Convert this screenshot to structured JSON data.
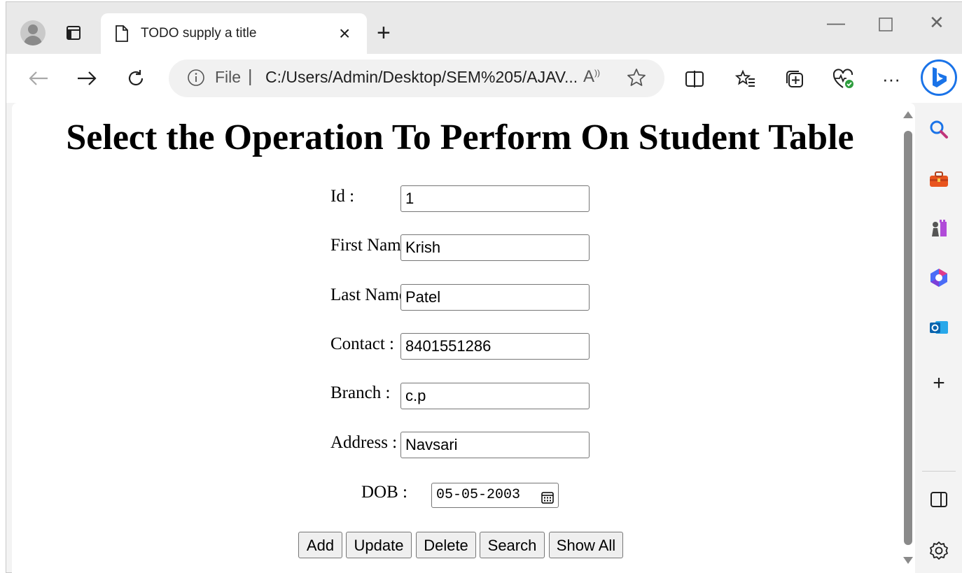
{
  "browser": {
    "tab_title": "TODO supply a title",
    "address": {
      "scheme_label": "File",
      "separator": "|",
      "url": "C:/Users/Admin/Desktop/SEM%205/AJAV...",
      "read_aloud": "A̩̕"
    },
    "icons": [
      "profile-icon",
      "tab-actions-icon",
      "page-icon",
      "close-tab-icon",
      "new-tab-icon",
      "minimize-icon",
      "maximize-icon",
      "close-window-icon",
      "back-icon",
      "forward-icon",
      "refresh-icon",
      "info-icon",
      "favorite-star-icon",
      "split-screen-icon",
      "favorites-icon",
      "collections-icon",
      "browser-essentials-icon",
      "more-icon",
      "bing-copilot-icon"
    ],
    "sidebar_icons": [
      "search-icon",
      "tools-icon",
      "games-icon",
      "microsoft365-icon",
      "outlook-icon",
      "add-icon",
      "sidebar-toggle-icon",
      "settings-icon"
    ]
  },
  "page": {
    "title": "Select the Operation To Perform On Student Table",
    "form": {
      "id_label": "Id :",
      "id_value": "1",
      "first_name_label": "First Name :",
      "first_name_value": "Krish",
      "last_name_label": "Last Name :",
      "last_name_value": "Patel",
      "contact_label": "Contact :",
      "contact_value": "8401551286",
      "branch_label": "Branch :",
      "branch_value": "c.p",
      "address_label": "Address :",
      "address_value": "Navsari",
      "dob_label": "DOB :",
      "dob_value": "05-05-2003"
    },
    "buttons": {
      "add": "Add",
      "update": "Update",
      "delete": "Delete",
      "search": "Search",
      "show_all": "Show All"
    }
  },
  "colors": {
    "accent": "#1a73e8",
    "scrollbar": "#8a8a8a",
    "button_bg": "#efefef"
  }
}
